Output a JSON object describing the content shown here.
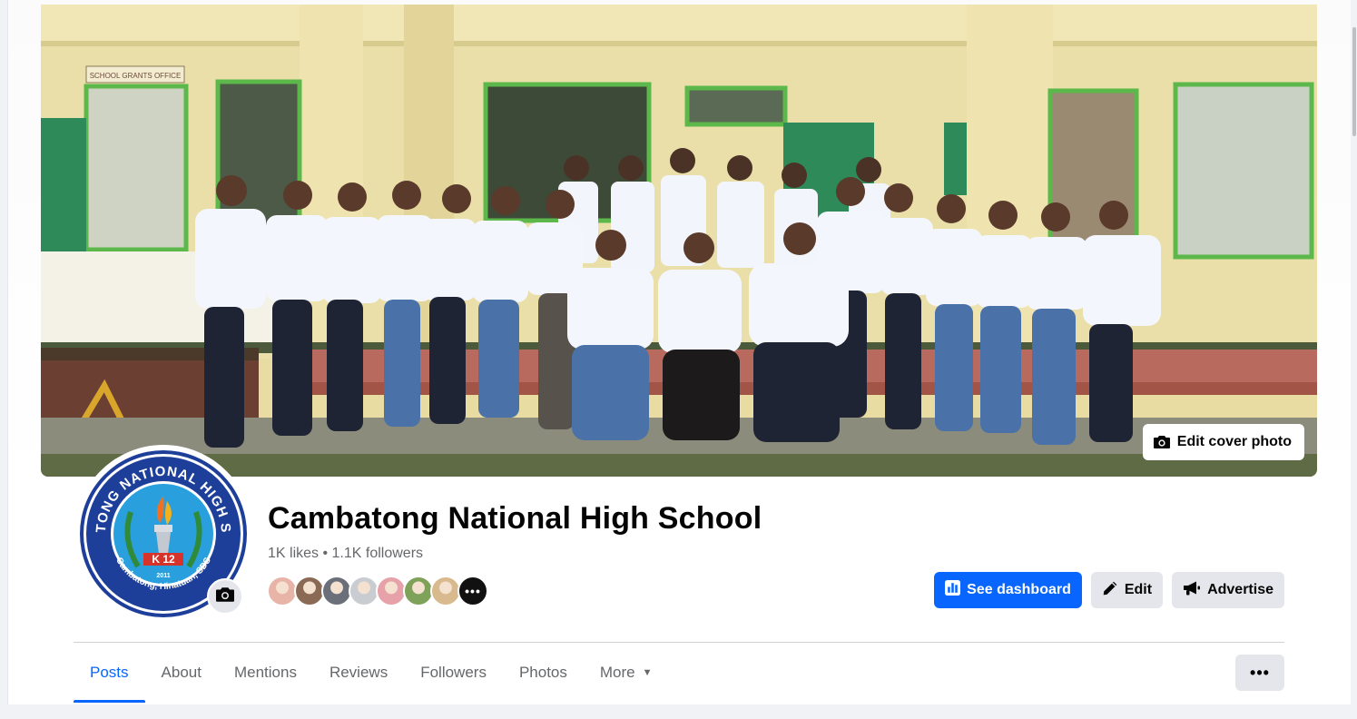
{
  "page": {
    "name": "Cambatong National High School",
    "likes": "1K likes",
    "separator": " • ",
    "followers": "1.1K followers"
  },
  "cover": {
    "edit_label": "Edit cover photo",
    "sign_text": "SCHOOL GRANTS OFFICE"
  },
  "logo": {
    "ring_text": "CAMBATONG NATIONAL HIGH SCHOOL",
    "bottom_text": "Cambatong, Hinatuan, SDS",
    "badge": "K 12",
    "year": "2011"
  },
  "follower_avatars": [
    {
      "name": "follower-avatar-1",
      "color": "#e8b4a8"
    },
    {
      "name": "follower-avatar-2",
      "color": "#8a6a55"
    },
    {
      "name": "follower-avatar-3",
      "color": "#6b6f7a"
    },
    {
      "name": "follower-avatar-4",
      "color": "#c9ccd1"
    },
    {
      "name": "follower-avatar-5",
      "color": "#e6a2a8"
    },
    {
      "name": "follower-avatar-6",
      "color": "#7fa25a"
    },
    {
      "name": "follower-avatar-7",
      "color": "#d9b98e"
    }
  ],
  "actions": {
    "dashboard": "See dashboard",
    "edit": "Edit",
    "advertise": "Advertise"
  },
  "tabs": [
    {
      "label": "Posts",
      "active": true
    },
    {
      "label": "About"
    },
    {
      "label": "Mentions"
    },
    {
      "label": "Reviews"
    },
    {
      "label": "Followers"
    },
    {
      "label": "Photos"
    },
    {
      "label": "More",
      "has_caret": true
    }
  ],
  "more_options_label": "•••",
  "colors": {
    "accent": "#0866ff",
    "secondary_button": "#e4e6eb",
    "muted_text": "#65676b"
  }
}
